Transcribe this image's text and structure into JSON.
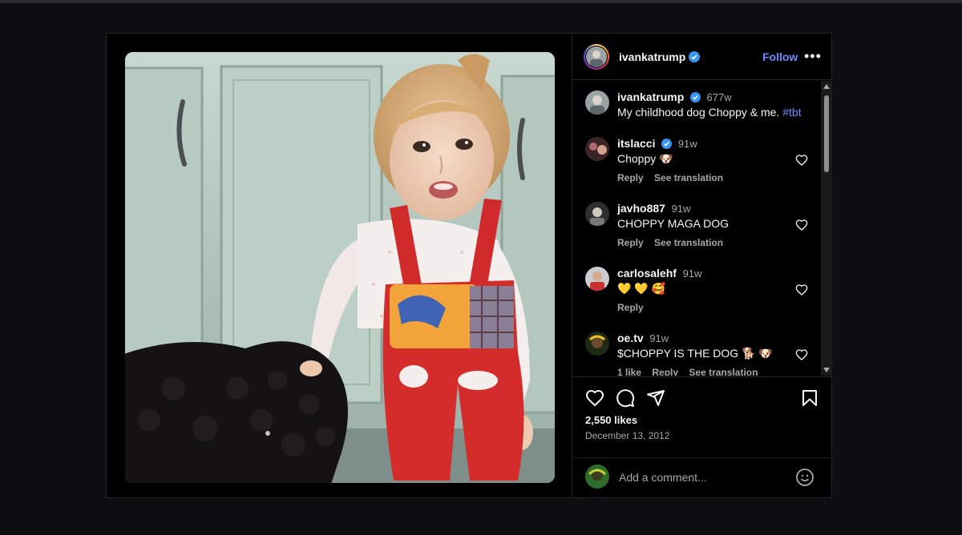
{
  "post": {
    "author": "ivankatrump",
    "follow_label": "Follow",
    "more_label": "•••",
    "caption": {
      "username": "ivankatrump",
      "time": "677w",
      "text": "My childhood dog Choppy & me.",
      "hashtag": "#tbt"
    },
    "comments": [
      {
        "username": "itslacci",
        "verified": true,
        "time": "91w",
        "text": "Choppy 🐶",
        "actions": [
          "Reply",
          "See translation"
        ]
      },
      {
        "username": "javho887",
        "verified": false,
        "time": "91w",
        "text": "CHOPPY MAGA DOG",
        "actions": [
          "Reply",
          "See translation"
        ]
      },
      {
        "username": "carlosalehf",
        "verified": false,
        "time": "91w",
        "text": "💛 💛 🥰",
        "actions": [
          "Reply"
        ]
      },
      {
        "username": "oe.tv",
        "verified": false,
        "time": "91w",
        "text": "$CHOPPY IS THE DOG 🐕 🐶",
        "actions": [
          "1 like",
          "Reply",
          "See translation"
        ]
      }
    ],
    "likes": "2,550 likes",
    "date": "December 13, 2012",
    "add_comment_placeholder": "Add a comment..."
  },
  "colors": {
    "accent_link": "#6f8cff",
    "background": "#0c0e12",
    "panel": "#000000",
    "muted_text": "#a8a8a8"
  },
  "icons": [
    "heart-icon",
    "comment-icon",
    "share-icon",
    "bookmark-icon",
    "emoji-icon",
    "verified-badge-icon"
  ]
}
